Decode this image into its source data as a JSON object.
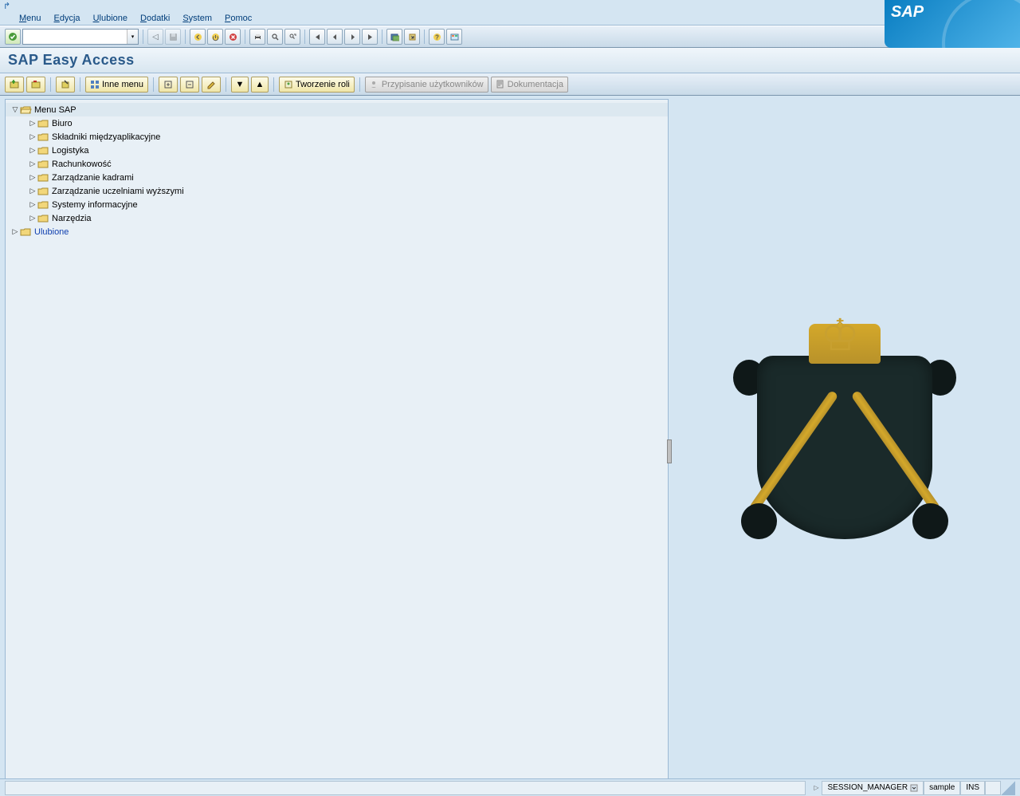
{
  "window_controls": {
    "minimize": "_",
    "maximize": "▢",
    "close": "✕"
  },
  "menubar": {
    "items": [
      {
        "label": "Menu",
        "ul": "M"
      },
      {
        "label": "Edycja",
        "ul": "E"
      },
      {
        "label": "Ulubione",
        "ul": "U"
      },
      {
        "label": "Dodatki",
        "ul": "D"
      },
      {
        "label": "System",
        "ul": "S"
      },
      {
        "label": "Pomoc",
        "ul": "P"
      }
    ]
  },
  "sap_logo": "SAP",
  "std_toolbar": {
    "command_field": "",
    "command_placeholder": ""
  },
  "title": "SAP Easy Access",
  "app_toolbar": {
    "inne_menu": "Inne menu",
    "tworzenie_roli": "Tworzenie roli",
    "przypisanie": "Przypisanie użytkowników",
    "dokumentacja": "Dokumentacja"
  },
  "tree": {
    "root": "Menu SAP",
    "children": [
      "Biuro",
      "Składniki międzyaplikacyjne",
      "Logistyka",
      "Rachunkowość",
      "Zarządzanie kadrami",
      "Zarządzanie uczelniami wyższymi",
      "Systemy informacyjne",
      "Narzędzia"
    ],
    "favorites": "Ulubione"
  },
  "status": {
    "transaction": "SESSION_MANAGER",
    "system": "sample",
    "mode": "INS"
  }
}
